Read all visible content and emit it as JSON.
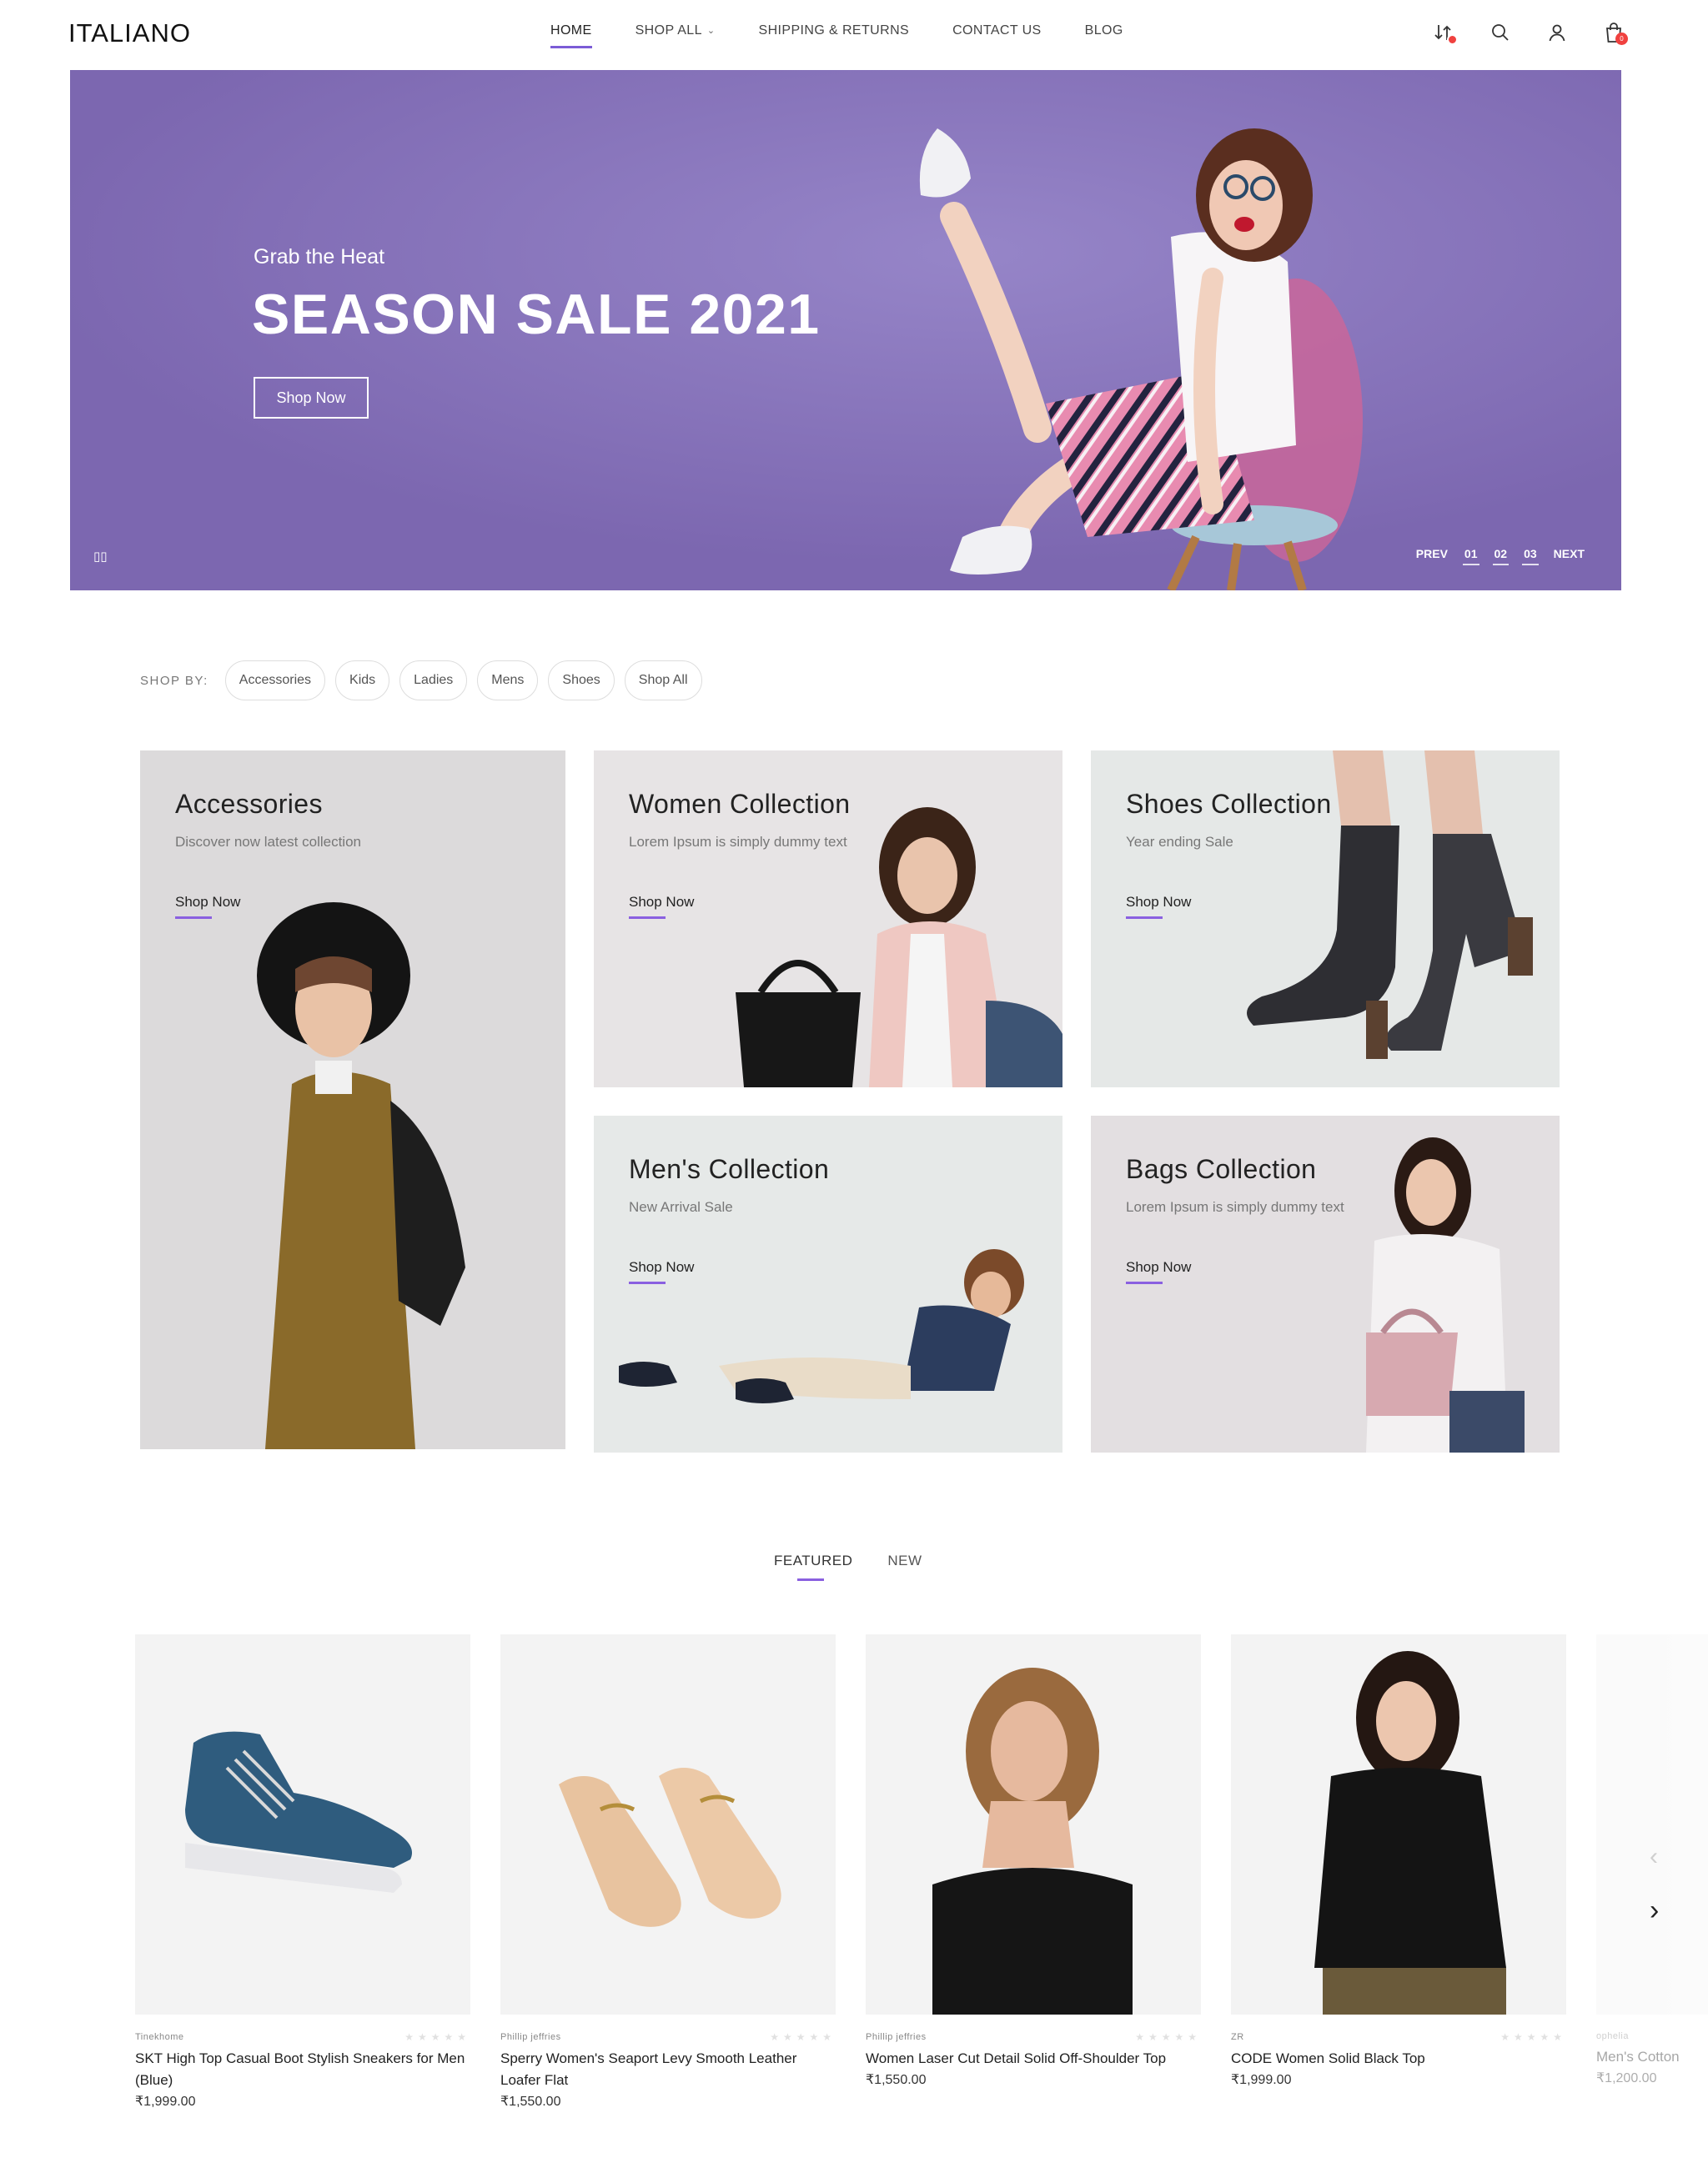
{
  "brand": {
    "logo": "ITALIANO"
  },
  "nav": {
    "items": [
      {
        "label": "HOME",
        "active": true
      },
      {
        "label": "SHOP ALL",
        "has_caret": true
      },
      {
        "label": "SHIPPING & RETURNS"
      },
      {
        "label": "CONTACT US"
      },
      {
        "label": "BLOG"
      }
    ],
    "icons": [
      "compare-icon",
      "search-icon",
      "user-icon",
      "cart-icon"
    ],
    "cart_badge": "0"
  },
  "hero": {
    "eyebrow": "Grab the Heat",
    "title": "SEASON SALE 2021",
    "button": "Shop Now",
    "pager": {
      "prev": "PREV",
      "pages": [
        "01",
        "02",
        "03"
      ],
      "next": "NEXT"
    },
    "background_color": "#8a75bb"
  },
  "shop_by": {
    "label": "SHOP BY:",
    "chips": [
      "Accessories",
      "Kids",
      "Ladies",
      "Mens",
      "Shoes",
      "Shop All"
    ]
  },
  "collections": [
    {
      "title": "Accessories",
      "subtitle": "Discover now latest collection",
      "link": "Shop Now"
    },
    {
      "title": "Women Collection",
      "subtitle": "Lorem Ipsum is simply dummy text",
      "link": "Shop Now"
    },
    {
      "title": "Shoes Collection",
      "subtitle": "Year ending Sale",
      "link": "Shop Now"
    },
    {
      "title": "Men's Collection",
      "subtitle": "New Arrival Sale",
      "link": "Shop Now"
    },
    {
      "title": "Bags Collection",
      "subtitle": "Lorem Ipsum is simply dummy text",
      "link": "Shop Now"
    }
  ],
  "tabs": [
    {
      "label": "FEATURED",
      "active": true
    },
    {
      "label": "NEW"
    }
  ],
  "products": [
    {
      "brand": "Tinekhome",
      "name": "SKT High Top Casual Boot Stylish Sneakers for Men (Blue)",
      "price": "₹1,999.00"
    },
    {
      "brand": "Phillip jeffries",
      "name": "Sperry Women's Seaport Levy Smooth Leather Loafer Flat",
      "price": "₹1,550.00"
    },
    {
      "brand": "Phillip jeffries",
      "name": "Women Laser Cut Detail Solid Off-Shoulder Top",
      "price": "₹1,550.00"
    },
    {
      "brand": "ZR",
      "name": "CODE Women Solid Black Top",
      "price": "₹1,999.00"
    },
    {
      "brand": "ophelia",
      "name": "Men's Cotton",
      "price": "₹1,200.00"
    }
  ],
  "stars": "★★★★★",
  "colors": {
    "accent": "#8a60e0",
    "badge": "#f0413f",
    "hero": "#8a75bb"
  }
}
